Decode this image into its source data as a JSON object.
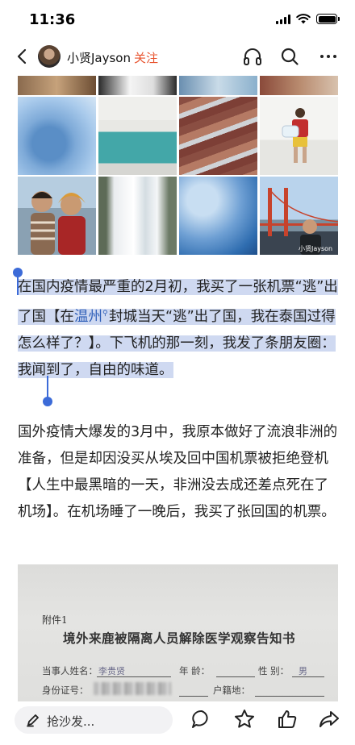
{
  "status_bar": {
    "time": "11:36"
  },
  "header": {
    "author_name": "小贤Jayson",
    "follow_label": "关注"
  },
  "photo_grid": {
    "watermark": "小贤Jayson"
  },
  "article": {
    "para1": {
      "part1": "在国内疫情最严重的2月初，我买了一张机票“逃”出了国【在",
      "link": "温州",
      "part2": "封城当天“逃”出了国，我在泰国过得怎么样了？】。下飞机的那一刻，我发了条朋友圈：我闻到了，自由的味道。"
    },
    "para2": "国外疫情大爆发的3月中，我原本做好了流浪非洲的准备，但是却因没买从埃及回中国机票被拒绝登机【人生中最黑暗的一天，非洲没去成还差点死在了机场】。在机场睡了一晚后，我买了张回国的机票。"
  },
  "document_image": {
    "attach_label": "附件1",
    "title": "境外来鹿被隔离人员解除医学观察告知书",
    "row1_label1": "当事人姓名：",
    "row1_value1": "李贵贤",
    "row1_label2": "年  龄：",
    "row1_label3": "性  别：",
    "row1_value3": "男",
    "row2_label1": "身份证号：",
    "row2_label2": "户籍地："
  },
  "bottom_bar": {
    "comment_placeholder": "抢沙发..."
  }
}
